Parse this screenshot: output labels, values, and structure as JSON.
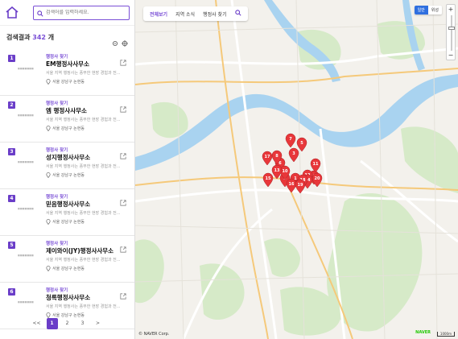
{
  "search": {
    "placeholder": "검색어를 입력하세요."
  },
  "results": {
    "label": "검색결과",
    "count": "342",
    "unit": "개"
  },
  "items": [
    {
      "num": "1",
      "category": "행정사 찾기",
      "name": "EM행정사사무소",
      "desc": "서울 지역 행정사는 풍부한 현장 경험과 전...",
      "addr": "서울 강남구 논현동"
    },
    {
      "num": "2",
      "category": "행정사 찾기",
      "name": "엠 행정사사무소",
      "desc": "서울 지역 행정사는 풍부한 현장 경험과 전...",
      "addr": "서울 강남구 논현동"
    },
    {
      "num": "3",
      "category": "행정사 찾기",
      "name": "성지행정사사무소",
      "desc": "서울 지역 행정사는 풍부한 현장 경험과 전...",
      "addr": "서울 강남구 논현동"
    },
    {
      "num": "4",
      "category": "행정사 찾기",
      "name": "믿음행정사사무소",
      "desc": "서울 지역 행정사는 풍부한 현장 경험과 전...",
      "addr": "서울 강남구 논현동"
    },
    {
      "num": "5",
      "category": "행정사 찾기",
      "name": "제이와이(JY)행정사사무소",
      "desc": "서울 지역 행정사는 풍부한 현장 경험과 전...",
      "addr": "서울 강남구 논현동"
    },
    {
      "num": "6",
      "category": "행정사 찾기",
      "name": "청록행정사사무소",
      "desc": "서울 지역 행정사는 풍부한 현장 경험과 전...",
      "addr": "서울 강남구 논현동"
    }
  ],
  "pagination": {
    "prev": "<<",
    "pages": [
      "1",
      "2",
      "3"
    ],
    "next": ">",
    "active": "1"
  },
  "mapnav": {
    "tabs": [
      "전체보기",
      "지역 소식",
      "행정사 찾기"
    ],
    "active": "전체보기"
  },
  "maptype": {
    "normal": "일반",
    "satellite": "위성"
  },
  "zoom": {
    "in": "+",
    "out": "−"
  },
  "markers": [
    "1",
    "2",
    "3",
    "4",
    "5",
    "6",
    "7",
    "8",
    "9",
    "10",
    "11",
    "12",
    "13",
    "14",
    "15",
    "16",
    "17",
    "18",
    "19",
    "20"
  ],
  "attribution": {
    "copyright": "© NAVER Corp.",
    "brand": "NAVER",
    "scale": "1000m"
  },
  "colors": {
    "accent": "#6a3dc8",
    "marker": "#e8373a",
    "river": "#a9d3f0",
    "park": "#cfe7c0"
  }
}
